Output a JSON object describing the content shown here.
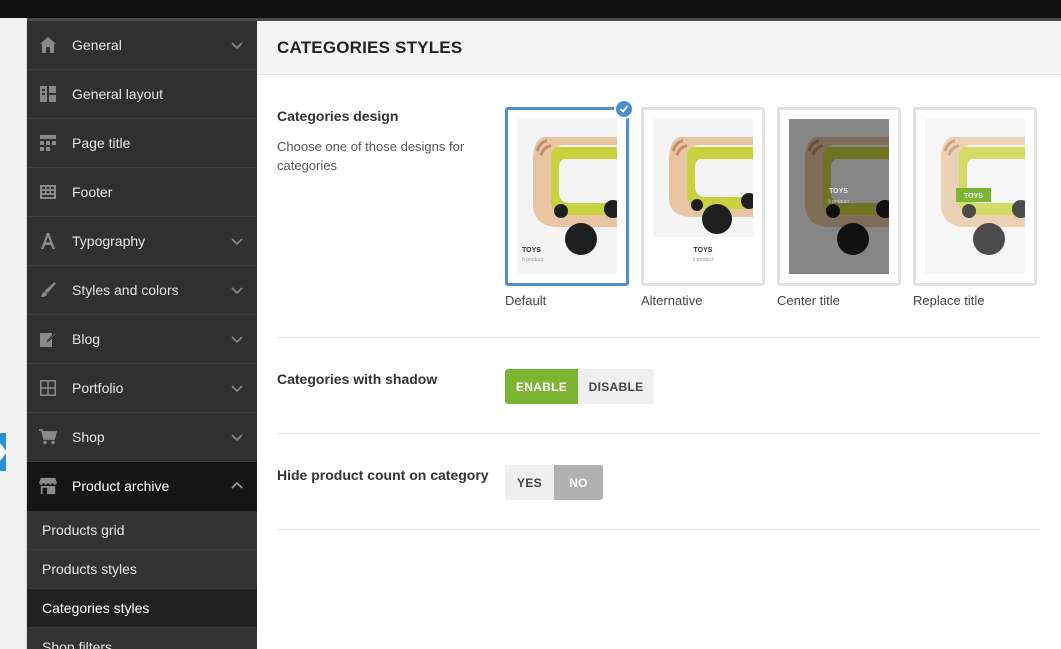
{
  "sidebar": {
    "items": [
      {
        "label": "General",
        "icon": "home-icon",
        "chevron": true
      },
      {
        "label": "General layout",
        "icon": "layout-icon",
        "chevron": false
      },
      {
        "label": "Page title",
        "icon": "page-title-icon",
        "chevron": false
      },
      {
        "label": "Footer",
        "icon": "footer-icon",
        "chevron": false
      },
      {
        "label": "Typography",
        "icon": "typography-icon",
        "chevron": true
      },
      {
        "label": "Styles and colors",
        "icon": "brush-icon",
        "chevron": true
      },
      {
        "label": "Blog",
        "icon": "edit-icon",
        "chevron": true
      },
      {
        "label": "Portfolio",
        "icon": "grid-icon",
        "chevron": true
      },
      {
        "label": "Shop",
        "icon": "cart-icon",
        "chevron": true
      },
      {
        "label": "Product archive",
        "icon": "store-icon",
        "chevron": true,
        "expanded": true
      }
    ],
    "subitems": [
      {
        "label": "Products grid"
      },
      {
        "label": "Products styles"
      },
      {
        "label": "Categories styles",
        "current": true
      },
      {
        "label": "Shop filters"
      }
    ]
  },
  "main": {
    "title": "CATEGORIES STYLES",
    "categories_design": {
      "label": "Categories design",
      "description": "Choose one of those designs for categories",
      "selected": "Default",
      "options": [
        {
          "caption": "Default",
          "thumb_title": "TOYS",
          "thumb_count": "5 product"
        },
        {
          "caption": "Alternative",
          "thumb_title": "TOYS",
          "thumb_count": "5 product"
        },
        {
          "caption": "Center title",
          "thumb_title": "TOYS",
          "thumb_count": "5 product"
        },
        {
          "caption": "Replace title",
          "thumb_title": "TOYS",
          "thumb_count": ""
        }
      ]
    },
    "shadow": {
      "label": "Categories with shadow",
      "enable": "ENABLE",
      "disable": "DISABLE",
      "value": "ENABLE"
    },
    "hide_count": {
      "label": "Hide product count on category",
      "yes": "YES",
      "no": "NO",
      "value": "NO"
    }
  },
  "colors": {
    "sidebar_bg": "#303030",
    "sidebar_active": "#151515",
    "accent_blue": "#4a8fd4",
    "enable_green": "#7cb532",
    "no_gray": "#b0b0b0",
    "toy_yellow": "#c8d23e",
    "toy_wood": "#e8c6a4"
  }
}
